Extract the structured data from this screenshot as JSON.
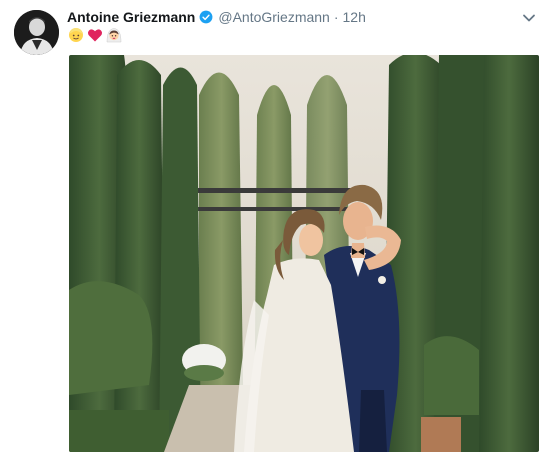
{
  "tweet": {
    "author_name": "Antoine Griezmann",
    "handle": "@AntoGriezmann",
    "separator": "·",
    "timestamp": "12h",
    "verified": true,
    "body_emojis": [
      "blond-person-emoji",
      "red-heart-emoji",
      "bride-with-veil-emoji"
    ],
    "image_description_icon": "wedding-photo",
    "colors": {
      "name": "#14171a",
      "secondary": "#657786",
      "verified": "#1da1f2",
      "heart": "#e0245e"
    }
  }
}
